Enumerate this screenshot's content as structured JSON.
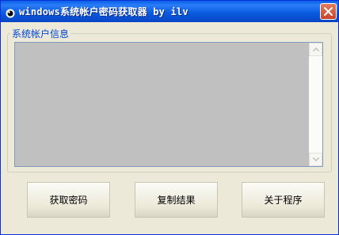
{
  "window": {
    "title": "windows系统帐户密码获取器 by ilv"
  },
  "group": {
    "label": "系统帐户信息",
    "content": ""
  },
  "buttons": {
    "get_password": "获取密码",
    "copy_result": "复制结果",
    "about": "关于程序"
  },
  "icons": {
    "app": "app-icon",
    "close": "close-icon",
    "scroll_up": "scroll-up-arrow-icon",
    "scroll_down": "scroll-down-arrow-icon"
  },
  "colors": {
    "titlebar": "#0a58de",
    "close_button": "#d3593a",
    "group_label": "#0046d5",
    "text_area_background": "#c0c0c0",
    "dialog_background": "#ece9d8"
  }
}
